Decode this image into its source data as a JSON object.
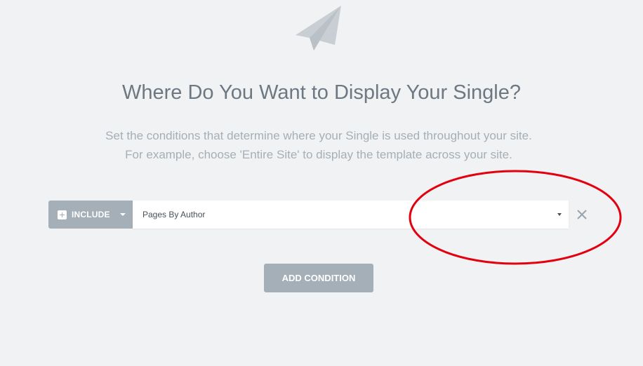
{
  "header": {
    "icon": "paper-plane-icon",
    "title": "Where Do You Want to Display Your Single?",
    "description_line1": "Set the conditions that determine where your Single is used throughout your site.",
    "description_line2": "For example, choose 'Entire Site' to display the template across your site."
  },
  "condition": {
    "type_label": "INCLUDE",
    "type_icon": "plus-square-icon",
    "selected_value": "Pages By Author",
    "remove_icon": "close-icon"
  },
  "actions": {
    "add_condition_label": "ADD CONDITION"
  },
  "annotation": {
    "color": "#e3000f",
    "shape": "ellipse"
  },
  "colors": {
    "background": "#f1f2f3",
    "muted_button": "#a4afb7",
    "title_text": "#6d7882",
    "desc_text": "#a4afb7"
  }
}
